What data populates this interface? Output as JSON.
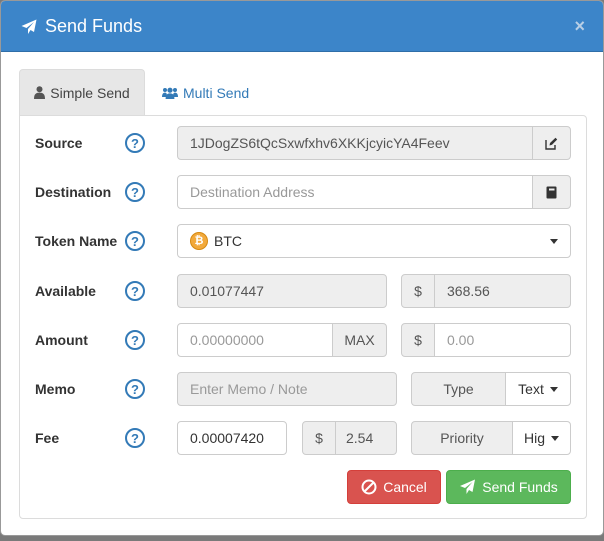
{
  "modal": {
    "title": "Send Funds",
    "close_glyph": "×",
    "send_icon": "paper-plane-icon"
  },
  "tabs": [
    {
      "label": "Simple Send",
      "icon": "user-icon",
      "active": true
    },
    {
      "label": "Multi Send",
      "icon": "users-icon",
      "active": false
    }
  ],
  "form": {
    "help_glyph": "?",
    "source": {
      "label": "Source",
      "value": "1JDogZS6tQcSxwfxhv6XKKjcyicYA4Feev",
      "icon": "edit-icon"
    },
    "destination": {
      "label": "Destination",
      "placeholder": "Destination Address",
      "icon": "address-book-icon"
    },
    "token": {
      "label": "Token Name",
      "value": "BTC",
      "icon": "bitcoin-icon",
      "coin_glyph": "₿"
    },
    "available": {
      "label": "Available",
      "value": "0.01077447",
      "currency": "$",
      "usd_value": "368.56"
    },
    "amount": {
      "label": "Amount",
      "placeholder": "0.00000000",
      "max_label": "MAX",
      "currency": "$",
      "usd_placeholder": "0.00"
    },
    "memo": {
      "label": "Memo",
      "placeholder": "Enter Memo / Note",
      "type_label": "Type",
      "type_value": "Text"
    },
    "fee": {
      "label": "Fee",
      "value": "0.00007420",
      "currency": "$",
      "usd_value": "2.54",
      "priority_label": "Priority",
      "priority_value": "Hig"
    }
  },
  "actions": {
    "cancel_label": "Cancel",
    "send_label": "Send Funds"
  },
  "colors": {
    "header": "#3c85c9",
    "cancel": "#d9534f",
    "send": "#5cb85c",
    "link": "#337ab7"
  }
}
